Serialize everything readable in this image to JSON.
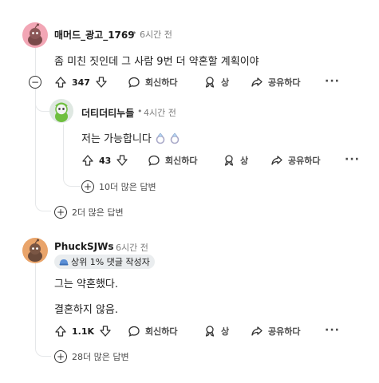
{
  "comment1": {
    "author": "매머드_광고_1769",
    "time": "6시간 전",
    "body": "좀 미친 짓인데 그 사람 9번 더 약혼할 계획이야",
    "votes": "347",
    "reply_label": "회신하다",
    "award_label": "상",
    "share_label": "공유하다",
    "more_replies": "2더 많은 답변"
  },
  "reply1": {
    "author": "더티더티누들",
    "time": "4시간 전",
    "body": "저는 가능합니다",
    "votes": "43",
    "reply_label": "회신하다",
    "award_label": "상",
    "share_label": "공유하다",
    "more_replies": "10더 많은 답변"
  },
  "comment2": {
    "author": "PhuckSJWs",
    "time": "6시간 전",
    "flair": "상위 1% 댓글 작성자",
    "body_line1": "그는 약혼했다.",
    "body_line2": "결혼하지 않음.",
    "votes": "1.1K",
    "reply_label": "회신하다",
    "award_label": "상",
    "share_label": "공유하다",
    "more_replies": "28더 많은 답변"
  },
  "icons": {
    "upvote": "upvote-arrow-icon",
    "downvote": "downvote-arrow-icon",
    "reply": "speech-bubble-icon",
    "award": "award-ribbon-icon",
    "share": "share-arrow-icon",
    "more": "ellipsis-icon",
    "ring": "ring-emoji-icon"
  },
  "colors": {
    "avatar1_bg": "#f2a6b5",
    "avatar2_bg": "#dfe8e2",
    "avatar3_bg": "#e9a46a",
    "thread_line": "#e5e7e9"
  }
}
